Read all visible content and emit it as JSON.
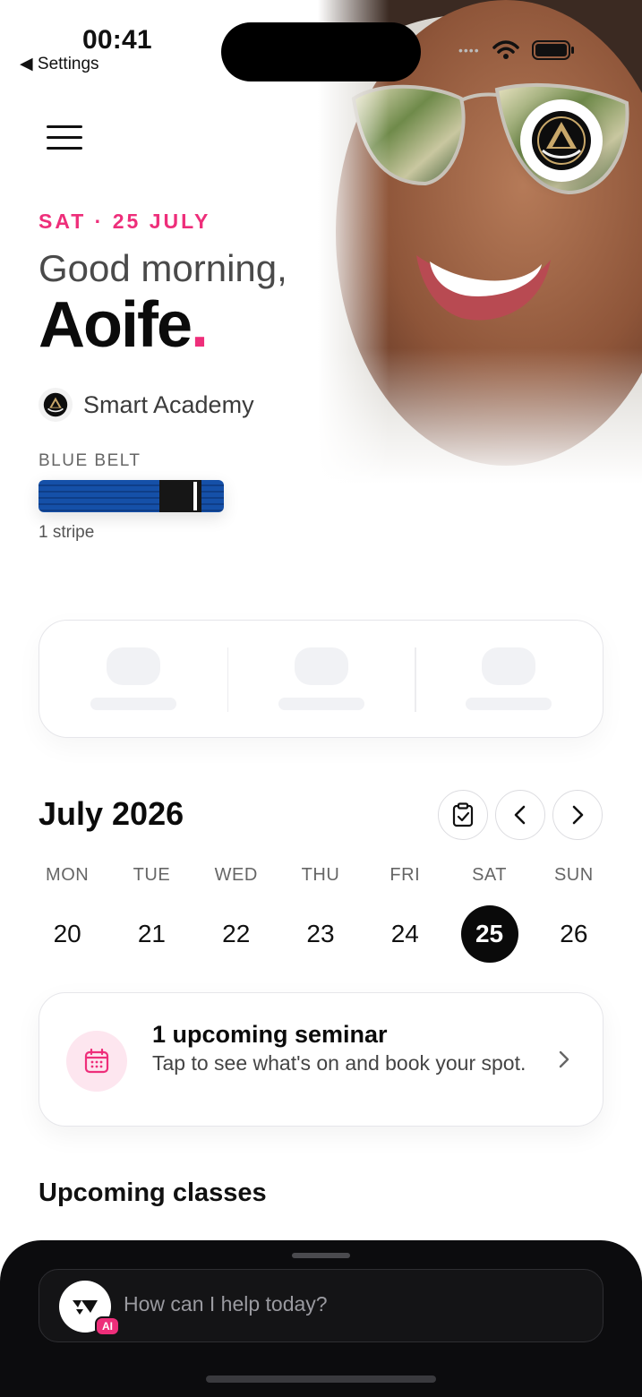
{
  "status_bar": {
    "time": "00:41",
    "back_label": "Settings"
  },
  "header": {
    "date": "SAT · 25 JULY",
    "greeting": "Good morning,",
    "name": "Aoife",
    "name_dot": ".",
    "academy_name": "Smart Academy"
  },
  "belt": {
    "label": "BLUE BELT",
    "stripes_text": "1 stripe",
    "color": "#1550a8",
    "stripes": 1
  },
  "calendar": {
    "month_title": "July 2026",
    "days": [
      {
        "dow": "MON",
        "num": "20"
      },
      {
        "dow": "TUE",
        "num": "21"
      },
      {
        "dow": "WED",
        "num": "22"
      },
      {
        "dow": "THU",
        "num": "23"
      },
      {
        "dow": "FRI",
        "num": "24"
      },
      {
        "dow": "SAT",
        "num": "25",
        "selected": true
      },
      {
        "dow": "SUN",
        "num": "26"
      }
    ]
  },
  "seminar": {
    "title": "1 upcoming seminar",
    "subtitle": "Tap to see what's on and book your spot."
  },
  "sections": {
    "upcoming_classes": "Upcoming classes"
  },
  "assistant": {
    "placeholder": "How can I help today?",
    "badge": "AI"
  },
  "colors": {
    "accent": "#ee2e7a",
    "selected_day": "#0a0a0a",
    "sheet": "#0c0c0e"
  },
  "icons": [
    "menu-icon",
    "club-logo-icon",
    "clipboard-check-icon",
    "chevron-left-icon",
    "chevron-right-icon",
    "calendar-icon",
    "assistant-logo-icon",
    "wifi-icon",
    "battery-icon"
  ]
}
